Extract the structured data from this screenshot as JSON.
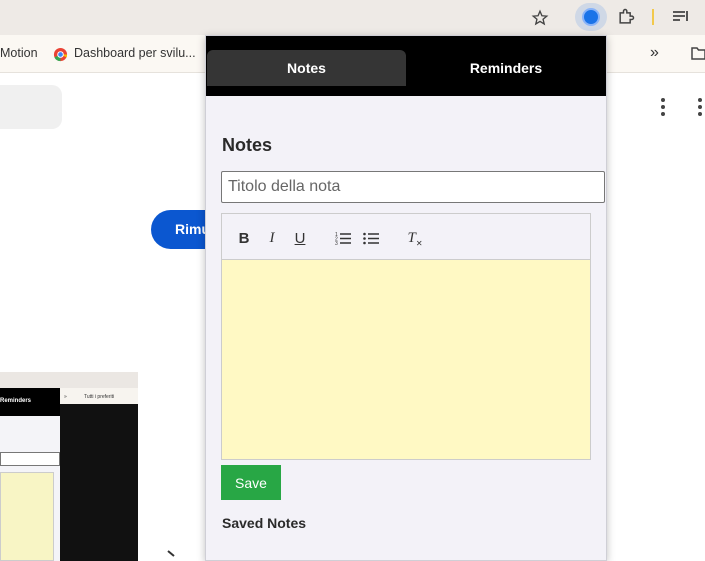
{
  "browser": {
    "bookmarks": {
      "item1": "Motion",
      "item2": "Dashboard per svilu..."
    },
    "overflow": "»"
  },
  "page": {
    "button_label": "Rimu",
    "thumbnail": {
      "tab_label": "Reminders",
      "bookmark_label": "Tutti i preferiti",
      "overflow": "»"
    }
  },
  "popup": {
    "tabs": [
      {
        "label": "Notes",
        "active": true
      },
      {
        "label": "Reminders",
        "active": false
      }
    ],
    "section_title": "Notes",
    "title_input": {
      "placeholder": "Titolo della nota",
      "value": ""
    },
    "editor_toolbar": {
      "bold": "B",
      "italic": "I",
      "underline": "U",
      "clear_format": "T"
    },
    "save_label": "Save",
    "saved_title": "Saved Notes"
  },
  "colors": {
    "tab_bar": "#000000",
    "active_tab": "#353535",
    "editor_bg": "#fff9c4",
    "save_button": "#28a745",
    "page_button": "#0b57d0"
  }
}
